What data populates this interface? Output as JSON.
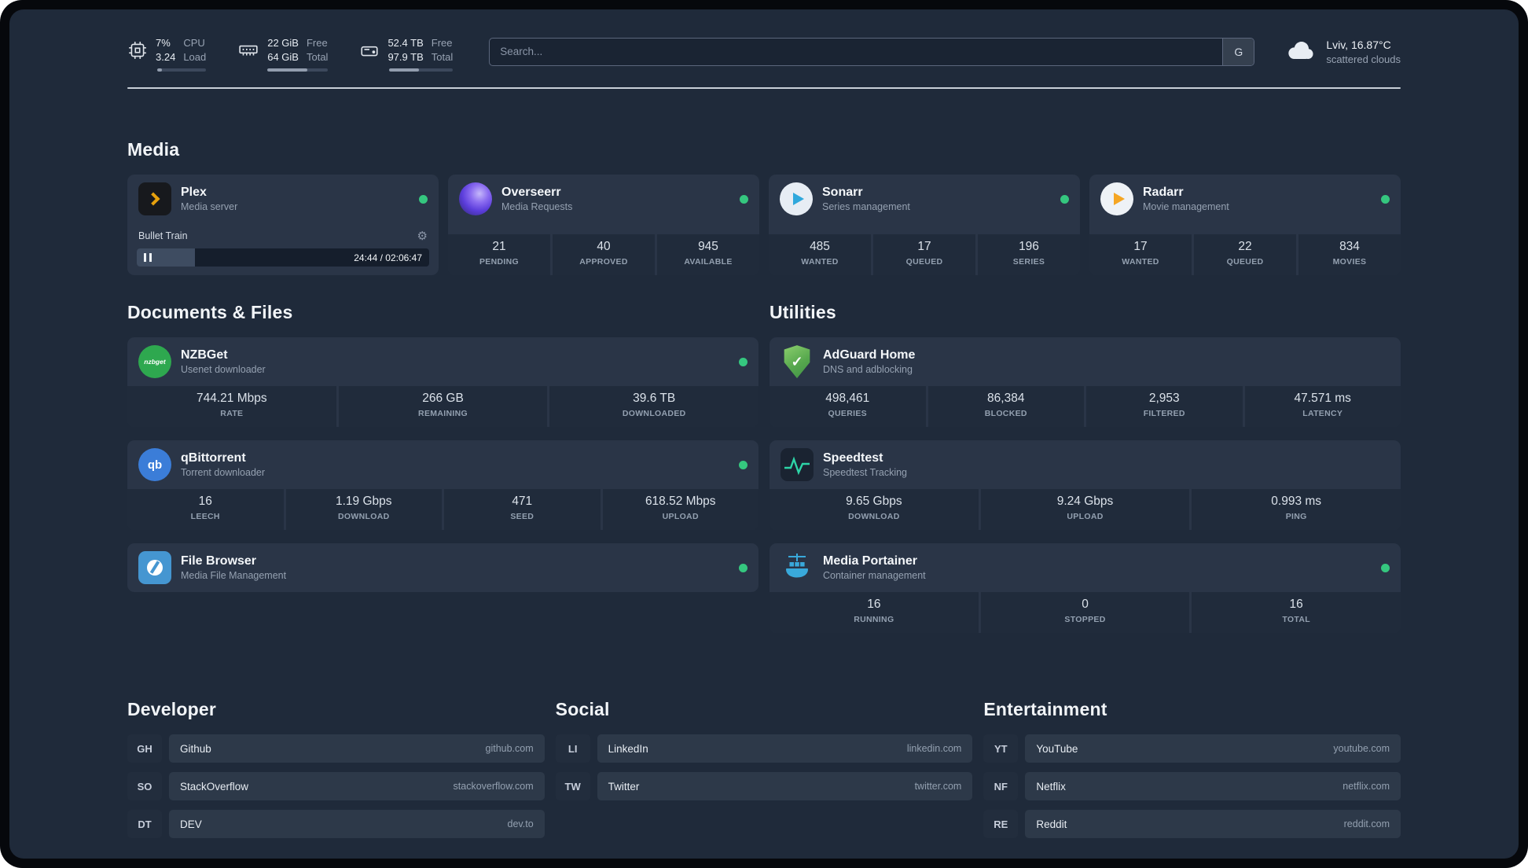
{
  "topbar": {
    "cpu": {
      "value1": "7%",
      "value2": "3.24",
      "label1": "CPU",
      "label2": "Load",
      "bar_percent": 10
    },
    "memory": {
      "value1": "22 GiB",
      "value2": "64 GiB",
      "label1": "Free",
      "label2": "Total",
      "bar_percent": 66
    },
    "disk": {
      "value1": "52.4 TB",
      "value2": "97.9 TB",
      "label1": "Free",
      "label2": "Total",
      "bar_percent": 47
    },
    "search": {
      "placeholder": "Search...",
      "button": "G"
    },
    "weather": {
      "location": "Lviv, 16.87°C",
      "condition": "scattered clouds"
    }
  },
  "icons": {
    "gear_glyph": "⚙",
    "check_glyph": "✓"
  },
  "media": {
    "title": "Media",
    "cards": [
      {
        "name": "Plex",
        "desc": "Media server",
        "widget": {
          "title": "Bullet Train",
          "time": "24:44 / 02:06:47",
          "progress_percent": 20
        }
      },
      {
        "name": "Overseerr",
        "desc": "Media Requests",
        "stats": [
          {
            "value": "21",
            "label": "PENDING"
          },
          {
            "value": "40",
            "label": "APPROVED"
          },
          {
            "value": "945",
            "label": "AVAILABLE"
          }
        ]
      },
      {
        "name": "Sonarr",
        "desc": "Series management",
        "stats": [
          {
            "value": "485",
            "label": "WANTED"
          },
          {
            "value": "17",
            "label": "QUEUED"
          },
          {
            "value": "196",
            "label": "SERIES"
          }
        ]
      },
      {
        "name": "Radarr",
        "desc": "Movie management",
        "stats": [
          {
            "value": "17",
            "label": "WANTED"
          },
          {
            "value": "22",
            "label": "QUEUED"
          },
          {
            "value": "834",
            "label": "MOVIES"
          }
        ]
      }
    ]
  },
  "documents": {
    "title": "Documents & Files",
    "cards": [
      {
        "name": "NZBGet",
        "desc": "Usenet downloader",
        "icon_text": "nzbget",
        "stats": [
          {
            "value": "744.21 Mbps",
            "label": "RATE"
          },
          {
            "value": "266 GB",
            "label": "REMAINING"
          },
          {
            "value": "39.6 TB",
            "label": "DOWNLOADED"
          }
        ]
      },
      {
        "name": "qBittorrent",
        "desc": "Torrent downloader",
        "icon_text": "qb",
        "stats": [
          {
            "value": "16",
            "label": "LEECH"
          },
          {
            "value": "1.19 Gbps",
            "label": "DOWNLOAD"
          },
          {
            "value": "471",
            "label": "SEED"
          },
          {
            "value": "618.52 Mbps",
            "label": "UPLOAD"
          }
        ]
      },
      {
        "name": "File Browser",
        "desc": "Media File Management"
      }
    ]
  },
  "utilities": {
    "title": "Utilities",
    "cards": [
      {
        "name": "AdGuard Home",
        "desc": "DNS and adblocking",
        "stats": [
          {
            "value": "498,461",
            "label": "QUERIES"
          },
          {
            "value": "86,384",
            "label": "BLOCKED"
          },
          {
            "value": "2,953",
            "label": "FILTERED"
          },
          {
            "value": "47.571 ms",
            "label": "LATENCY"
          }
        ]
      },
      {
        "name": "Speedtest",
        "desc": "Speedtest Tracking",
        "stats": [
          {
            "value": "9.65 Gbps",
            "label": "DOWNLOAD"
          },
          {
            "value": "9.24 Gbps",
            "label": "UPLOAD"
          },
          {
            "value": "0.993 ms",
            "label": "PING"
          }
        ]
      },
      {
        "name": "Media Portainer",
        "desc": "Container management",
        "stats": [
          {
            "value": "16",
            "label": "RUNNING"
          },
          {
            "value": "0",
            "label": "STOPPED"
          },
          {
            "value": "16",
            "label": "TOTAL"
          }
        ]
      }
    ]
  },
  "bookmarks": {
    "developer": {
      "title": "Developer",
      "items": [
        {
          "abbr": "GH",
          "name": "Github",
          "domain": "github.com"
        },
        {
          "abbr": "SO",
          "name": "StackOverflow",
          "domain": "stackoverflow.com"
        },
        {
          "abbr": "DT",
          "name": "DEV",
          "domain": "dev.to"
        }
      ]
    },
    "social": {
      "title": "Social",
      "items": [
        {
          "abbr": "LI",
          "name": "LinkedIn",
          "domain": "linkedin.com"
        },
        {
          "abbr": "TW",
          "name": "Twitter",
          "domain": "twitter.com"
        }
      ]
    },
    "entertainment": {
      "title": "Entertainment",
      "items": [
        {
          "abbr": "YT",
          "name": "YouTube",
          "domain": "youtube.com"
        },
        {
          "abbr": "NF",
          "name": "Netflix",
          "domain": "netflix.com"
        },
        {
          "abbr": "RE",
          "name": "Reddit",
          "domain": "reddit.com"
        }
      ]
    }
  }
}
